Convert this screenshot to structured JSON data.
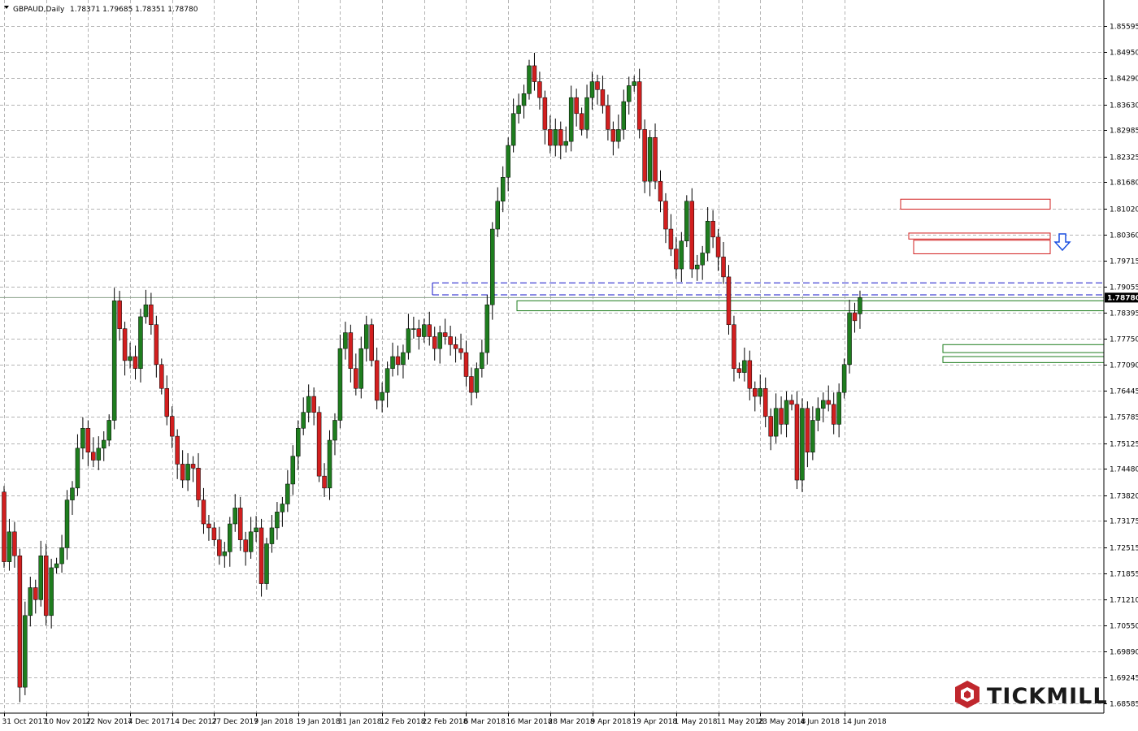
{
  "header": {
    "symbol_label": "GBPAUD,Daily",
    "ohlc_text": "1.78371 1.79685 1.78351 1.78780",
    "menu_arrow_icon": "triangle-down-icon"
  },
  "brand": {
    "name": "TICKMILL",
    "logo_icon": "tickmill-hexagon-logo-icon",
    "color": "#c0272d"
  },
  "colors": {
    "bull": "#1e7d1e",
    "bear": "#d21f1f",
    "zone_resistance": "#d21f1f",
    "zone_support": "#1e7d1e",
    "dashed_level": "#1515c8",
    "signal_arrow": "#1a4fe0",
    "current_price_bg": "#000000"
  },
  "current_price_label": "1.78780",
  "chart_data": {
    "type": "candlestick",
    "symbol": "GBPAUD",
    "timeframe": "Daily",
    "ylim": [
      1.6835,
      1.8625
    ],
    "y_ticks": [
      "1.85595",
      "1.84950",
      "1.84290",
      "1.83630",
      "1.82985",
      "1.82325",
      "1.81680",
      "1.81020",
      "1.80360",
      "1.79715",
      "1.79055",
      "1.78395",
      "1.77750",
      "1.77090",
      "1.76445",
      "1.75785",
      "1.75125",
      "1.74480",
      "1.73820",
      "1.73175",
      "1.72515",
      "1.71855",
      "1.71210",
      "1.70550",
      "1.69890",
      "1.69245",
      "1.68585"
    ],
    "x_labels": [
      {
        "label": "31 Oct 2017",
        "i": 0
      },
      {
        "label": "10 Nov 2017",
        "i": 8
      },
      {
        "label": "22 Nov 2017",
        "i": 16
      },
      {
        "label": "4 Dec 2017",
        "i": 24
      },
      {
        "label": "14 Dec 2017",
        "i": 32
      },
      {
        "label": "27 Dec 2017",
        "i": 40
      },
      {
        "label": "9 Jan 2018",
        "i": 48
      },
      {
        "label": "19 Jan 2018",
        "i": 56
      },
      {
        "label": "31 Jan 2018",
        "i": 64
      },
      {
        "label": "12 Feb 2018",
        "i": 72
      },
      {
        "label": "22 Feb 2018",
        "i": 80
      },
      {
        "label": "6 Mar 2018",
        "i": 88
      },
      {
        "label": "16 Mar 2018",
        "i": 96
      },
      {
        "label": "28 Mar 2018",
        "i": 104
      },
      {
        "label": "9 Apr 2018",
        "i": 112
      },
      {
        "label": "19 Apr 2018",
        "i": 120
      },
      {
        "label": "1 May 2018",
        "i": 128
      },
      {
        "label": "11 May 2018",
        "i": 136
      },
      {
        "label": "23 May 2018",
        "i": 144
      },
      {
        "label": "4 Jun 2018",
        "i": 152
      },
      {
        "label": "14 Jun 2018",
        "i": 160
      }
    ],
    "closes": [
      1.7215,
      1.729,
      1.723,
      1.69,
      1.708,
      1.715,
      1.712,
      1.723,
      1.708,
      1.72,
      1.721,
      1.725,
      1.737,
      1.74,
      1.75,
      1.755,
      1.749,
      1.747,
      1.75,
      1.752,
      1.757,
      1.787,
      1.78,
      1.772,
      1.773,
      1.77,
      1.783,
      1.786,
      1.781,
      1.771,
      1.765,
      1.758,
      1.753,
      1.746,
      1.742,
      1.746,
      1.745,
      1.737,
      1.731,
      1.73,
      1.727,
      1.723,
      1.724,
      1.731,
      1.735,
      1.727,
      1.724,
      1.729,
      1.73,
      1.716,
      1.726,
      1.73,
      1.734,
      1.736,
      1.741,
      1.748,
      1.755,
      1.759,
      1.763,
      1.759,
      1.743,
      1.74,
      1.752,
      1.757,
      1.775,
      1.779,
      1.77,
      1.765,
      1.775,
      1.781,
      1.772,
      1.762,
      1.764,
      1.77,
      1.773,
      1.771,
      1.774,
      1.78,
      1.78,
      1.778,
      1.781,
      1.778,
      1.775,
      1.779,
      1.778,
      1.776,
      1.775,
      1.774,
      1.768,
      1.764,
      1.77,
      1.774,
      1.786,
      1.805,
      1.812,
      1.818,
      1.826,
      1.834,
      1.836,
      1.839,
      1.846,
      1.842,
      1.838,
      1.83,
      1.826,
      1.83,
      1.826,
      1.827,
      1.838,
      1.834,
      1.83,
      1.838,
      1.842,
      1.84,
      1.836,
      1.83,
      1.827,
      1.83,
      1.837,
      1.841,
      1.842,
      1.83,
      1.817,
      1.828,
      1.817,
      1.812,
      1.805,
      1.8,
      1.795,
      1.802,
      1.812,
      1.795,
      1.796,
      1.799,
      1.807,
      1.803,
      1.798,
      1.793,
      1.781,
      1.77,
      1.769,
      1.772,
      1.765,
      1.763,
      1.765,
      1.758,
      1.753,
      1.76,
      1.756,
      1.762,
      1.761,
      1.742,
      1.76,
      1.749,
      1.757,
      1.76,
      1.762,
      1.761,
      1.756,
      1.764,
      1.771,
      1.784,
      1.782,
      1.7878
    ],
    "opens": [
      1.739,
      1.7215,
      1.729,
      1.723,
      1.69,
      1.708,
      1.715,
      1.712,
      1.723,
      1.708,
      1.72,
      1.721,
      1.725,
      1.737,
      1.74,
      1.75,
      1.755,
      1.749,
      1.747,
      1.75,
      1.752,
      1.757,
      1.787,
      1.78,
      1.772,
      1.773,
      1.77,
      1.783,
      1.786,
      1.781,
      1.771,
      1.765,
      1.758,
      1.753,
      1.746,
      1.742,
      1.746,
      1.745,
      1.737,
      1.731,
      1.73,
      1.727,
      1.723,
      1.724,
      1.731,
      1.735,
      1.727,
      1.724,
      1.729,
      1.73,
      1.716,
      1.726,
      1.73,
      1.734,
      1.736,
      1.741,
      1.748,
      1.755,
      1.759,
      1.763,
      1.759,
      1.743,
      1.74,
      1.752,
      1.757,
      1.775,
      1.779,
      1.77,
      1.765,
      1.775,
      1.781,
      1.772,
      1.762,
      1.764,
      1.77,
      1.773,
      1.771,
      1.774,
      1.78,
      1.78,
      1.778,
      1.781,
      1.778,
      1.775,
      1.779,
      1.778,
      1.776,
      1.775,
      1.774,
      1.768,
      1.764,
      1.77,
      1.774,
      1.786,
      1.805,
      1.812,
      1.818,
      1.826,
      1.834,
      1.836,
      1.839,
      1.846,
      1.842,
      1.838,
      1.83,
      1.826,
      1.83,
      1.826,
      1.827,
      1.838,
      1.834,
      1.83,
      1.838,
      1.842,
      1.84,
      1.836,
      1.83,
      1.827,
      1.83,
      1.837,
      1.841,
      1.842,
      1.83,
      1.817,
      1.828,
      1.817,
      1.812,
      1.805,
      1.8,
      1.795,
      1.802,
      1.812,
      1.795,
      1.796,
      1.799,
      1.807,
      1.803,
      1.798,
      1.793,
      1.781,
      1.77,
      1.769,
      1.772,
      1.765,
      1.763,
      1.765,
      1.758,
      1.753,
      1.76,
      1.756,
      1.762,
      1.761,
      1.742,
      1.76,
      1.749,
      1.757,
      1.76,
      1.762,
      1.761,
      1.756,
      1.764,
      1.771,
      1.784,
      1.78371
    ],
    "highs_extra": 0.0025,
    "levels": {
      "resistance_zones": [
        [
          1.81,
          1.8125
        ],
        [
          1.8025,
          1.804
        ],
        [
          1.7988,
          1.8022
        ]
      ],
      "support_zones": [
        [
          1.7845,
          1.787
        ],
        [
          1.7715,
          1.773
        ],
        [
          1.774,
          1.776
        ]
      ],
      "dashed_levels": [
        1.7915,
        1.7885
      ],
      "current_price": 1.7878
    }
  }
}
